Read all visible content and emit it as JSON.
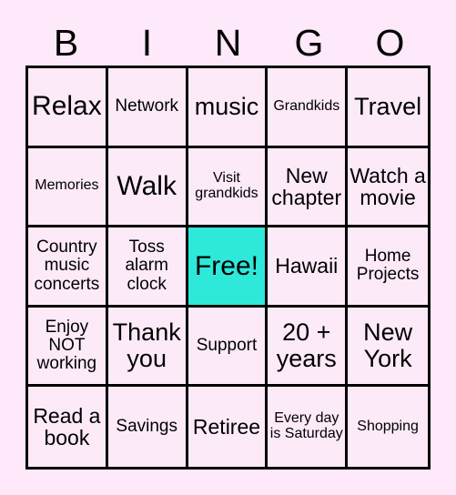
{
  "card": {
    "title": "BINGO",
    "header_letters": [
      "B",
      "I",
      "N",
      "G",
      "O"
    ],
    "colors": {
      "background": "#fde9f9",
      "cell_background": "#fdeaf9",
      "free_space": "#2ee8da",
      "border": "#000000",
      "text": "#000000"
    },
    "grid_size": "5x5",
    "free_space_position": "row 3, column 3",
    "rows": [
      [
        {
          "text": "Relax",
          "size": "fs-xl",
          "free": false
        },
        {
          "text": "Network",
          "size": "fs-sm",
          "free": false
        },
        {
          "text": "music",
          "size": "fs-lg",
          "free": false
        },
        {
          "text": "Grandkids",
          "size": "fs-xs",
          "free": false
        },
        {
          "text": "Travel",
          "size": "fs-lg",
          "free": false
        }
      ],
      [
        {
          "text": "Memories",
          "size": "fs-xs",
          "free": false
        },
        {
          "text": "Walk",
          "size": "fs-xl",
          "free": false
        },
        {
          "text": "Visit grandkids",
          "size": "fs-xs",
          "free": false
        },
        {
          "text": "New chapter",
          "size": "fs-md",
          "free": false
        },
        {
          "text": "Watch a movie",
          "size": "fs-md",
          "free": false
        }
      ],
      [
        {
          "text": "Country music concerts",
          "size": "fs-sm",
          "free": false
        },
        {
          "text": "Toss alarm clock",
          "size": "fs-sm",
          "free": false
        },
        {
          "text": "Free!",
          "size": "fs-xl",
          "free": true
        },
        {
          "text": "Hawaii",
          "size": "fs-md",
          "free": false
        },
        {
          "text": "Home Projects",
          "size": "fs-sm",
          "free": false
        }
      ],
      [
        {
          "text": "Enjoy NOT working",
          "size": "fs-sm",
          "free": false
        },
        {
          "text": "Thank you",
          "size": "fs-lg",
          "free": false
        },
        {
          "text": "Support",
          "size": "fs-sm",
          "free": false
        },
        {
          "text": "20 + years",
          "size": "fs-lg",
          "free": false
        },
        {
          "text": "New York",
          "size": "fs-lg",
          "free": false
        }
      ],
      [
        {
          "text": "Read a book",
          "size": "fs-md",
          "free": false
        },
        {
          "text": "Savings",
          "size": "fs-sm",
          "free": false
        },
        {
          "text": "Retiree",
          "size": "fs-md",
          "free": false
        },
        {
          "text": "Every day is Saturday",
          "size": "fs-xs",
          "free": false
        },
        {
          "text": "Shopping",
          "size": "fs-xs",
          "free": false
        }
      ]
    ]
  }
}
